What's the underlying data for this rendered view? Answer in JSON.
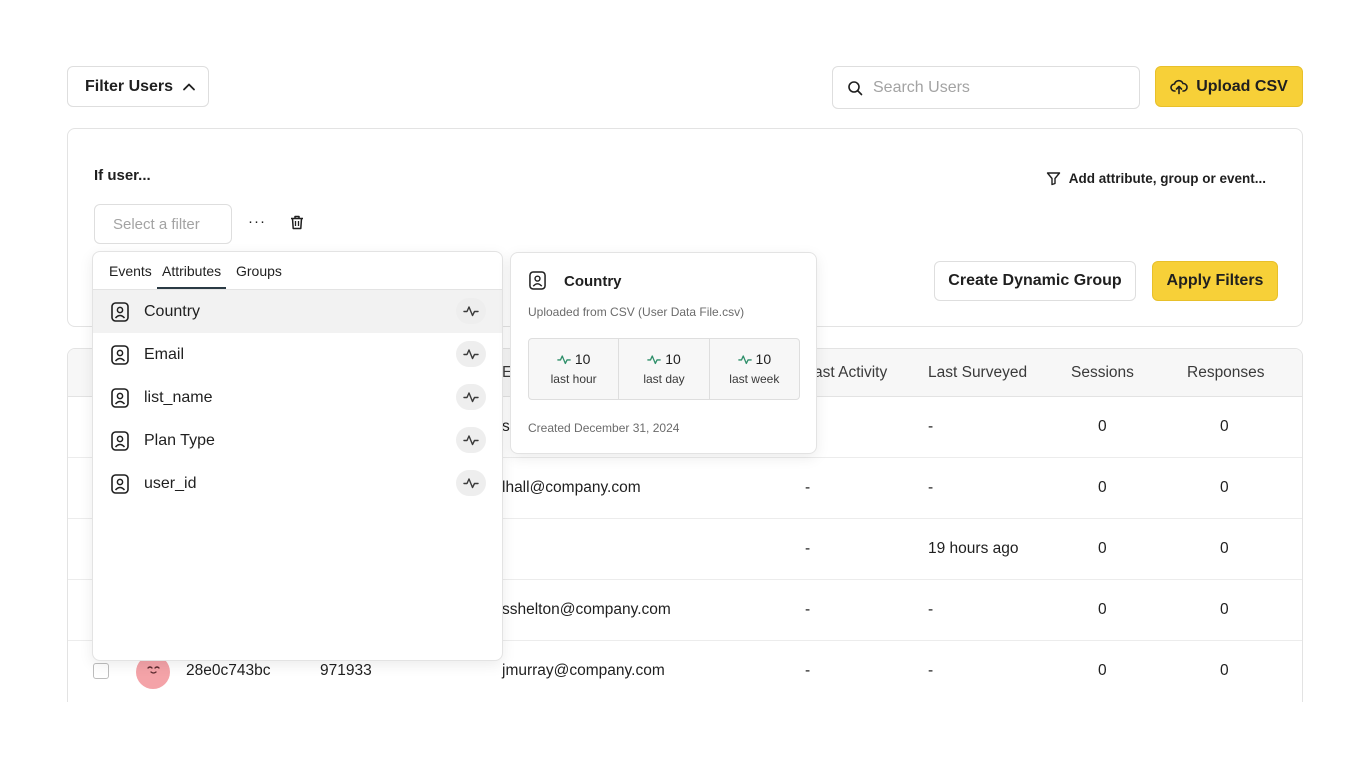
{
  "toolbar": {
    "filter_users_label": "Filter Users",
    "search_placeholder": "Search Users",
    "upload_label": "Upload CSV"
  },
  "filter_panel": {
    "heading": "If user...",
    "add_attribute_label": "Add attribute, group or event...",
    "select_placeholder": "Select a filter",
    "more_label": "···",
    "create_group_label": "Create Dynamic Group",
    "apply_label": "Apply Filters"
  },
  "dropdown": {
    "tabs": [
      "Events",
      "Attributes",
      "Groups"
    ],
    "active_tab": "Attributes",
    "items": [
      "Country",
      "Email",
      "list_name",
      "Plan Type",
      "user_id"
    ]
  },
  "tooltip": {
    "title": "Country",
    "subtitle": "Uploaded from CSV (User Data File.csv)",
    "stats": [
      {
        "value": "10",
        "label": "last hour"
      },
      {
        "value": "10",
        "label": "last day"
      },
      {
        "value": "10",
        "label": "last week"
      }
    ],
    "created": "Created December 31, 2024"
  },
  "table": {
    "headers": {
      "email_partial": "E",
      "last_activity_partial": "ast Activity",
      "last_surveyed": "Last Surveyed",
      "sessions": "Sessions",
      "responses": "Responses"
    },
    "rows": [
      {
        "email": "s",
        "last_activity": "",
        "last_surveyed": "-",
        "sessions": "0",
        "responses": "0"
      },
      {
        "email": "lhall@company.com",
        "last_activity": "-",
        "last_surveyed": "-",
        "sessions": "0",
        "responses": "0"
      },
      {
        "email": "",
        "last_activity": "-",
        "last_surveyed": "19 hours ago",
        "sessions": "0",
        "responses": "0"
      },
      {
        "email": "sshelton@company.com",
        "last_activity": "-",
        "last_surveyed": "-",
        "sessions": "0",
        "responses": "0"
      },
      {
        "user_id": "28e0c743bc",
        "external_id": "971933",
        "email": "jmurray@company.com",
        "last_activity": "-",
        "last_surveyed": "-",
        "sessions": "0",
        "responses": "0"
      }
    ]
  },
  "colors": {
    "accent": "#f7d038",
    "pulse_green": "#2f8f6a",
    "avatar_pink": "#f4a3a8"
  },
  "icons": {
    "chevron": "chevron-up-icon",
    "search": "search-icon",
    "upload": "cloud-upload-icon",
    "filter": "funnel-icon",
    "trash": "trash-icon",
    "person": "person-badge-icon",
    "pulse": "activity-pulse-icon"
  }
}
